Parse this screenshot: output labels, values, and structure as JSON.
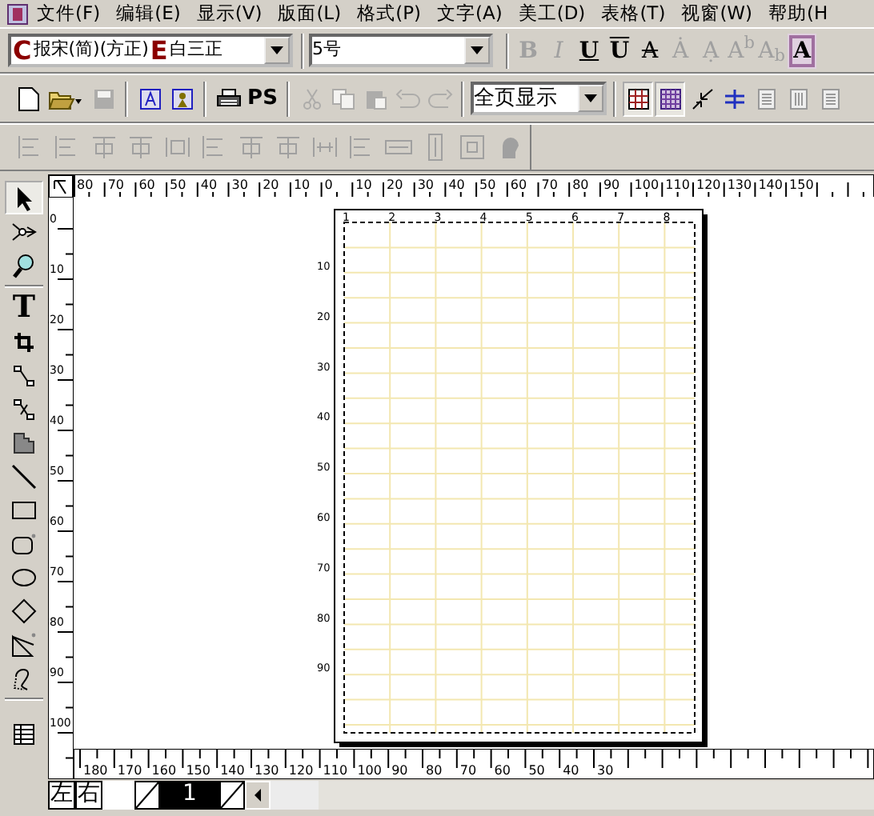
{
  "menu": [
    "文件(F)",
    "编辑(E)",
    "显示(V)",
    "版面(L)",
    "格式(P)",
    "文字(A)",
    "美工(D)",
    "表格(T)",
    "视窗(W)",
    "帮助(H"
  ],
  "font_toolbar": {
    "chinese_prefix": "C",
    "chinese_font": "报宋(简)(方正)",
    "english_prefix": "E",
    "english_font": "白三正",
    "size": "5号",
    "format_buttons": [
      {
        "label": "B",
        "kind": "bold",
        "disabled": true
      },
      {
        "label": "I",
        "kind": "italic",
        "disabled": true
      },
      {
        "label": "U",
        "kind": "underline",
        "disabled": false
      },
      {
        "label": "U",
        "kind": "overline",
        "disabled": false
      },
      {
        "label": "A",
        "kind": "strike",
        "disabled": false
      },
      {
        "label": "Ȧ",
        "kind": "plain",
        "disabled": true
      },
      {
        "label": "Ạ",
        "kind": "plain",
        "disabled": true
      },
      {
        "label": "A$^{b}$",
        "kind": "plain",
        "disabled": true
      },
      {
        "label": "A$_{b}$",
        "kind": "plain",
        "disabled": true
      },
      {
        "label": "A",
        "kind": "boxed",
        "disabled": false
      }
    ]
  },
  "main_toolbar": [
    {
      "kind": "new",
      "disabled": false
    },
    {
      "kind": "open",
      "disabled": false
    },
    {
      "kind": "save",
      "disabled": true
    },
    {
      "kind": "text-frame",
      "disabled": false
    },
    {
      "kind": "image-frame",
      "disabled": false
    },
    {
      "kind": "print",
      "disabled": false
    },
    {
      "kind": "ps",
      "label": "PS",
      "disabled": false
    },
    {
      "kind": "cut",
      "disabled": true
    },
    {
      "kind": "copy",
      "disabled": true
    },
    {
      "kind": "paste",
      "disabled": true
    },
    {
      "kind": "undo",
      "disabled": true
    },
    {
      "kind": "redo",
      "disabled": true
    },
    {
      "kind": "zoom-select",
      "value": "全页显示"
    },
    {
      "kind": "grid",
      "pressed": true
    },
    {
      "kind": "grid2",
      "pressed": true
    },
    {
      "kind": "arrows",
      "pressed": false
    },
    {
      "kind": "cross",
      "pressed": false
    },
    {
      "kind": "lines",
      "pressed": false
    },
    {
      "kind": "columns",
      "pressed": false
    },
    {
      "kind": "lines",
      "pressed": false
    }
  ],
  "align_toolbar": [
    {
      "kind": "h-align",
      "disabled": true
    },
    {
      "kind": "h-align",
      "disabled": true
    },
    {
      "kind": "v-align",
      "disabled": true
    },
    {
      "kind": "v-align",
      "disabled": true
    },
    {
      "kind": "frame",
      "disabled": true
    },
    {
      "kind": "h-align",
      "disabled": true
    },
    {
      "kind": "v-align",
      "disabled": true
    },
    {
      "kind": "v-align",
      "disabled": true
    },
    {
      "kind": "distribute",
      "disabled": true
    },
    {
      "kind": "h-align",
      "disabled": true
    },
    {
      "kind": "width",
      "disabled": true
    },
    {
      "kind": "height",
      "disabled": true
    },
    {
      "kind": "center",
      "disabled": true
    },
    {
      "kind": "head",
      "disabled": true
    }
  ],
  "tools": [
    {
      "kind": "pointer",
      "selected": true
    },
    {
      "kind": "node",
      "selected": false
    },
    {
      "kind": "zoom",
      "selected": false
    },
    {
      "kind": "text",
      "label": "T",
      "selected": false
    },
    {
      "kind": "crop",
      "selected": false
    },
    {
      "kind": "link",
      "selected": false
    },
    {
      "kind": "unlink",
      "selected": false
    },
    {
      "kind": "shade",
      "selected": false
    },
    {
      "kind": "line",
      "selected": false
    },
    {
      "kind": "rect",
      "selected": false
    },
    {
      "kind": "round-rect",
      "selected": false
    },
    {
      "kind": "ellipse",
      "selected": false
    },
    {
      "kind": "diamond",
      "selected": false
    },
    {
      "kind": "polygon",
      "selected": false
    },
    {
      "kind": "bezier",
      "selected": false
    },
    {
      "kind": "table",
      "selected": false
    }
  ],
  "top_ruler": [
    "80",
    "70",
    "60",
    "50",
    "40",
    "30",
    "20",
    "10",
    "0",
    "10",
    "20",
    "30",
    "40",
    "50",
    "60",
    "70",
    "80",
    "90",
    "100",
    "110",
    "120",
    "130",
    "140",
    "150"
  ],
  "left_ruler": [
    "0",
    "10",
    "20",
    "30",
    "40",
    "50",
    "60",
    "70",
    "80",
    "90",
    "100"
  ],
  "bottom_ruler": [
    "180",
    "170",
    "160",
    "150",
    "140",
    "130",
    "120",
    "110",
    "100",
    "90",
    "80",
    "70",
    "60",
    "50",
    "40",
    "30"
  ],
  "page": {
    "columns": [
      "1",
      "2",
      "3",
      "4",
      "5",
      "6",
      "7",
      "8"
    ],
    "rows": [
      "10",
      "20",
      "30",
      "40",
      "50",
      "60",
      "70",
      "80",
      "90"
    ]
  },
  "page_bar": {
    "left": "左",
    "right": "右",
    "pages": [
      {
        "label": "1",
        "selected": true
      }
    ]
  }
}
